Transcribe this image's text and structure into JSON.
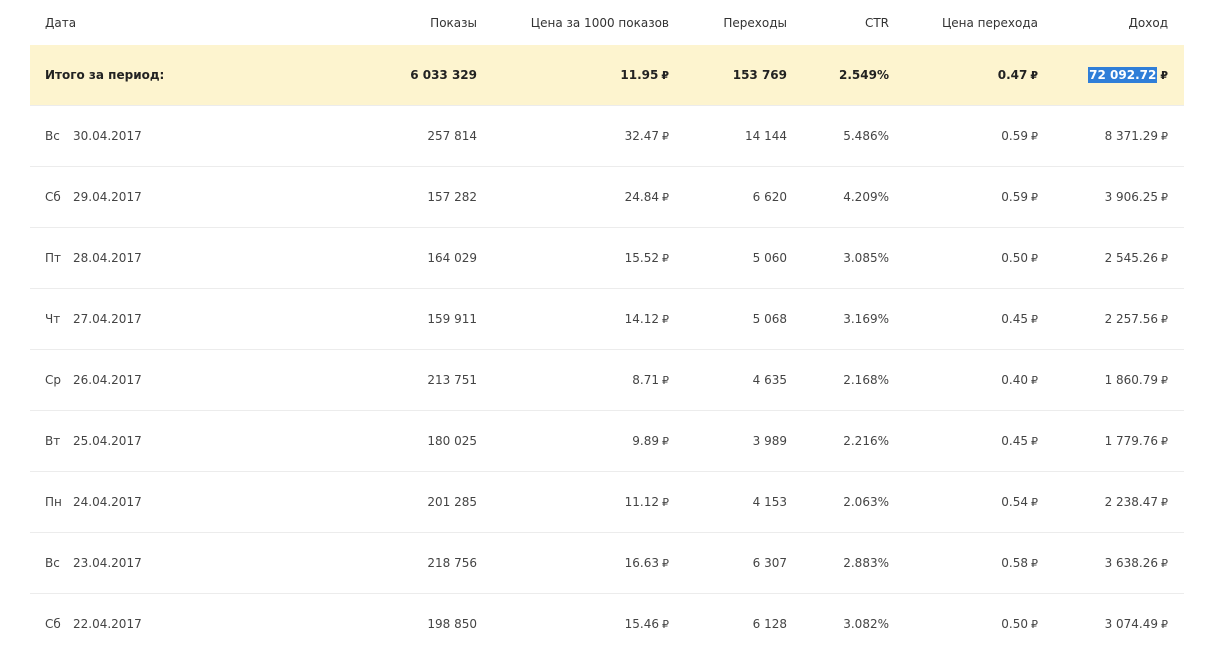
{
  "headers": {
    "date": "Дата",
    "shows": "Показы",
    "cpm": "Цена за 1000 показов",
    "clicks": "Переходы",
    "ctr": "CTR",
    "cpc": "Цена перехода",
    "income": "Доход"
  },
  "currency": "₽",
  "total": {
    "label": "Итого за период:",
    "shows": "6 033 329",
    "cpm": "11.95",
    "clicks": "153 769",
    "ctr": "2.549%",
    "cpc": "0.47",
    "income": "72 092.72"
  },
  "rows": [
    {
      "day": "Вс",
      "date": "30.04.2017",
      "weekend": true,
      "shows": "257 814",
      "cpm": "32.47",
      "clicks": "14 144",
      "ctr": "5.486%",
      "cpc": "0.59",
      "income": "8 371.29"
    },
    {
      "day": "Сб",
      "date": "29.04.2017",
      "weekend": true,
      "shows": "157 282",
      "cpm": "24.84",
      "clicks": "6 620",
      "ctr": "4.209%",
      "cpc": "0.59",
      "income": "3 906.25"
    },
    {
      "day": "Пт",
      "date": "28.04.2017",
      "weekend": false,
      "shows": "164 029",
      "cpm": "15.52",
      "clicks": "5 060",
      "ctr": "3.085%",
      "cpc": "0.50",
      "income": "2 545.26"
    },
    {
      "day": "Чт",
      "date": "27.04.2017",
      "weekend": false,
      "shows": "159 911",
      "cpm": "14.12",
      "clicks": "5 068",
      "ctr": "3.169%",
      "cpc": "0.45",
      "income": "2 257.56"
    },
    {
      "day": "Ср",
      "date": "26.04.2017",
      "weekend": false,
      "shows": "213 751",
      "cpm": "8.71",
      "clicks": "4 635",
      "ctr": "2.168%",
      "cpc": "0.40",
      "income": "1 860.79"
    },
    {
      "day": "Вт",
      "date": "25.04.2017",
      "weekend": false,
      "shows": "180 025",
      "cpm": "9.89",
      "clicks": "3 989",
      "ctr": "2.216%",
      "cpc": "0.45",
      "income": "1 779.76"
    },
    {
      "day": "Пн",
      "date": "24.04.2017",
      "weekend": false,
      "shows": "201 285",
      "cpm": "11.12",
      "clicks": "4 153",
      "ctr": "2.063%",
      "cpc": "0.54",
      "income": "2 238.47"
    },
    {
      "day": "Вс",
      "date": "23.04.2017",
      "weekend": true,
      "shows": "218 756",
      "cpm": "16.63",
      "clicks": "6 307",
      "ctr": "2.883%",
      "cpc": "0.58",
      "income": "3 638.26"
    },
    {
      "day": "Сб",
      "date": "22.04.2017",
      "weekend": true,
      "shows": "198 850",
      "cpm": "15.46",
      "clicks": "6 128",
      "ctr": "3.082%",
      "cpc": "0.50",
      "income": "3 074.49"
    }
  ],
  "colors": {
    "weekend": "#d0393a",
    "total_bg": "#fdf4cf",
    "selection": "#2f7ed8"
  }
}
